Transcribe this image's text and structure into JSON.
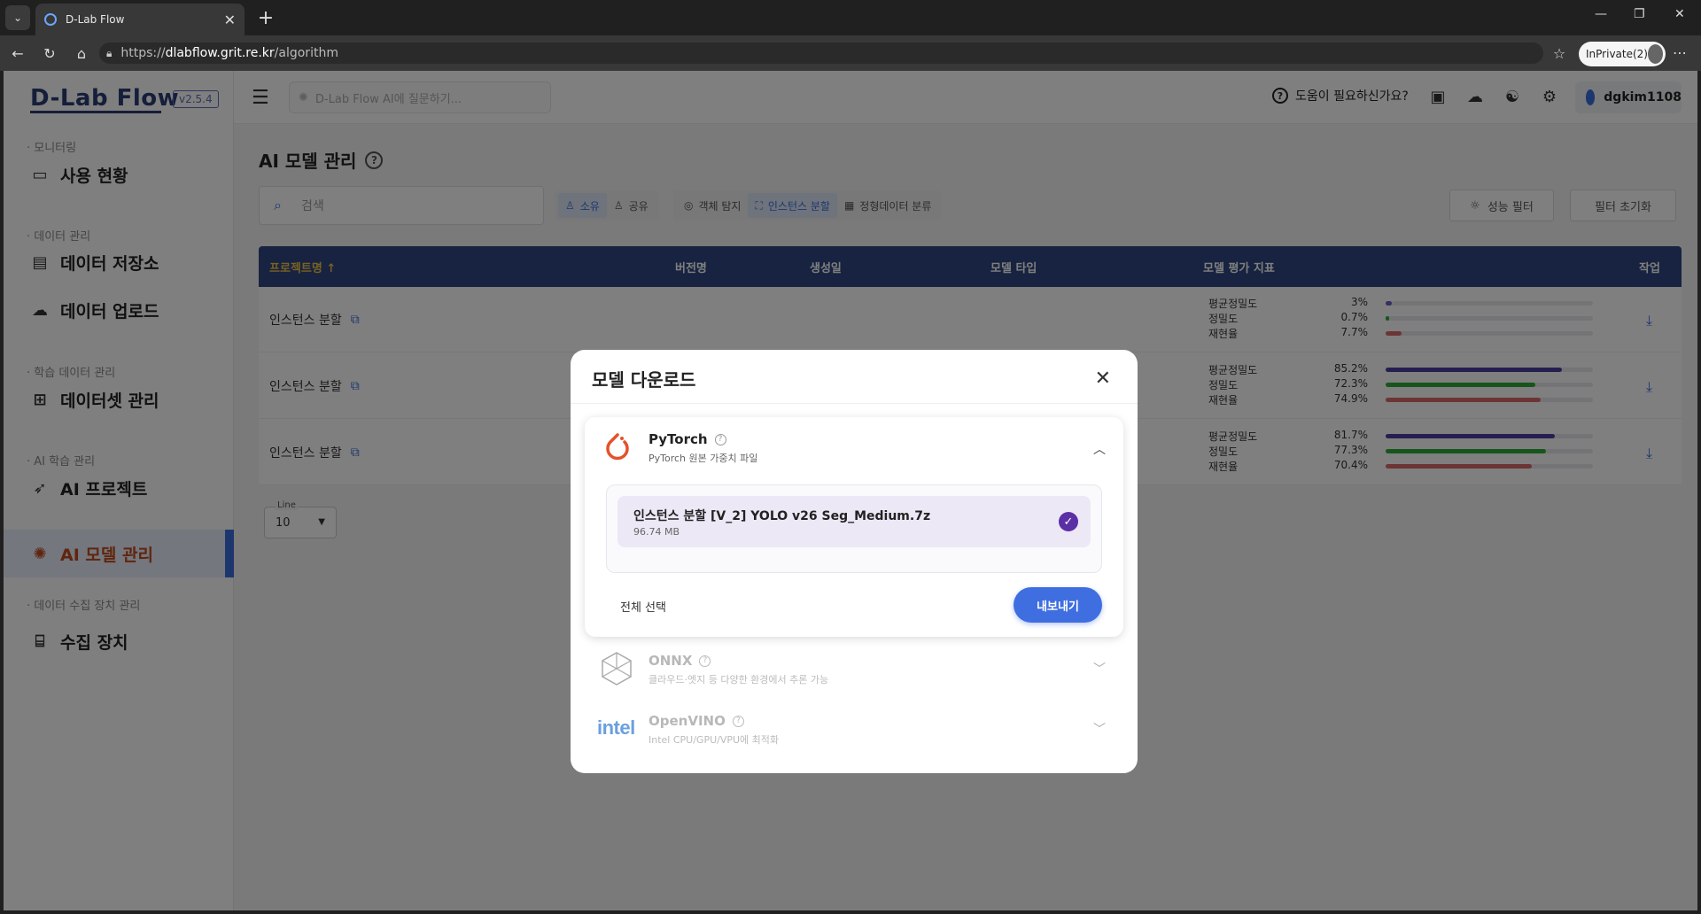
{
  "browser": {
    "tab_title": "D-Lab Flow",
    "url_prefix": "https://",
    "url_host": "dlabflow.grit.re.kr",
    "url_path": "/algorithm",
    "inprivate": "InPrivate(2)"
  },
  "app": {
    "brand": "D-Lab Flow",
    "version": "v2.5.4",
    "ai_search_placeholder": "D-Lab Flow AI에 질문하기...",
    "help": "도움이 필요하신가요?",
    "username": "dgkim1108"
  },
  "sidebar": {
    "sections": {
      "monitoring": "· 모니터링",
      "data": "· 데이터 관리",
      "train_data": "· 학습 데이터 관리",
      "ai_train": "· AI 학습 관리",
      "devices": "· 데이터 수집 장치 관리"
    },
    "items": {
      "usage": "사용 현황",
      "storage": "데이터 저장소",
      "upload": "데이터 업로드",
      "dataset": "데이터셋 관리",
      "project": "AI 프로젝트",
      "model": "AI 모델 관리",
      "device": "수집 장치"
    }
  },
  "page": {
    "title": "AI 모델 관리",
    "search_placeholder": "검색",
    "chips": {
      "own": "소유",
      "shared": "공유",
      "detection": "객체 탐지",
      "instance": "인스턴스 분할",
      "tabular": "정형데이터 분류"
    },
    "perf_filter": "성능 필터",
    "reset_filter": "필터 초기화",
    "line_label": "Line",
    "line_value": "10"
  },
  "table": {
    "headers": {
      "project": "프로젝트명 ↑",
      "version": "버전명",
      "created": "생성일",
      "model_type": "모델 타입",
      "metrics": "모델 평가 지표",
      "action": "작업"
    },
    "metric_labels": [
      "평균정밀도",
      "정밀도",
      "재현율"
    ],
    "rows": [
      {
        "project": "인스턴스 분할",
        "map": "3%",
        "precision": "0.7%",
        "recall": "7.7%",
        "map_v": 3,
        "prec_v": 0.7,
        "rec_v": 7.7
      },
      {
        "project": "인스턴스 분할",
        "map": "85.2%",
        "precision": "72.3%",
        "recall": "74.9%",
        "map_v": 85.2,
        "prec_v": 72.3,
        "rec_v": 74.9
      },
      {
        "project": "인스턴스 분할",
        "map": "81.7%",
        "precision": "77.3%",
        "recall": "70.4%",
        "map_v": 81.7,
        "prec_v": 77.3,
        "rec_v": 70.4
      }
    ],
    "colors": {
      "map": "#4b3fa0",
      "precision": "#2faa3a",
      "recall": "#d86a6a",
      "low_map": "#6a5fc8"
    }
  },
  "modal": {
    "title": "모델 다운로드",
    "pytorch": {
      "name": "PyTorch",
      "desc": "PyTorch 원본 가중치 파일"
    },
    "file": {
      "name": "인스턴스 분할 [V_2] YOLO v26 Seg_Medium.7z",
      "size": "96.74 MB"
    },
    "select_all": "전체 선택",
    "export": "내보내기",
    "onnx": {
      "name": "ONNX",
      "desc": "클라우드·엣지 등 다양한 환경에서 추론 가능"
    },
    "openvino": {
      "name": "OpenVINO",
      "desc": "Intel CPU/GPU/VPU에 최적화",
      "logo_text": "intel"
    }
  }
}
